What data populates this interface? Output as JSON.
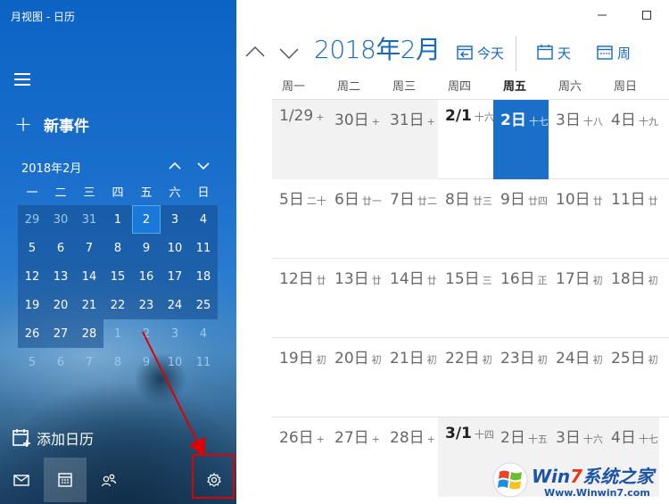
{
  "window": {
    "title": "月视图 - 日历"
  },
  "sidebar": {
    "new_event_label": "新事件",
    "mini_calendar": {
      "month_label": "2018年2月",
      "weekdays": [
        "一",
        "二",
        "三",
        "四",
        "五",
        "六",
        "日"
      ],
      "weeks": [
        [
          "29",
          "30",
          "31",
          "1",
          "2",
          "3",
          "4"
        ],
        [
          "5",
          "6",
          "7",
          "8",
          "9",
          "10",
          "11"
        ],
        [
          "12",
          "13",
          "14",
          "15",
          "16",
          "17",
          "18"
        ],
        [
          "19",
          "20",
          "21",
          "22",
          "23",
          "24",
          "25"
        ],
        [
          "26",
          "27",
          "28",
          "1",
          "2",
          "3",
          "4"
        ],
        [
          "5",
          "6",
          "7",
          "8",
          "9",
          "10",
          "11"
        ]
      ]
    },
    "add_calendar_label": "添加日历",
    "bottom_nav": [
      "mail-icon",
      "calendar-icon",
      "people-icon",
      "settings-icon"
    ]
  },
  "toolbar": {
    "month_title": "2018年2月",
    "today_label": "今天",
    "day_label": "天",
    "week_label": "周"
  },
  "month_view": {
    "weekdays": [
      "周一",
      "周二",
      "周三",
      "周四",
      "周五",
      "周六",
      "周日"
    ],
    "current_weekday": "周五",
    "weeks": [
      [
        {
          "d": "1/29",
          "l": "+"
        },
        {
          "d": "30日",
          "l": "+"
        },
        {
          "d": "31日",
          "l": "+"
        },
        {
          "d": "2/1",
          "l": "十六"
        },
        {
          "d": "2日",
          "l": "十七"
        },
        {
          "d": "3日",
          "l": "十八"
        },
        {
          "d": "4日",
          "l": "十九"
        }
      ],
      [
        {
          "d": "5日",
          "l": "二十"
        },
        {
          "d": "6日",
          "l": "廿一"
        },
        {
          "d": "7日",
          "l": "廿二"
        },
        {
          "d": "8日",
          "l": "廿三"
        },
        {
          "d": "9日",
          "l": "廿四"
        },
        {
          "d": "10日",
          "l": "廿"
        },
        {
          "d": "11日",
          "l": "廿"
        }
      ],
      [
        {
          "d": "12日",
          "l": "廿"
        },
        {
          "d": "13日",
          "l": "廿"
        },
        {
          "d": "14日",
          "l": "廿"
        },
        {
          "d": "15日",
          "l": "三"
        },
        {
          "d": "16日",
          "l": "正"
        },
        {
          "d": "17日",
          "l": "初"
        },
        {
          "d": "18日",
          "l": "初"
        }
      ],
      [
        {
          "d": "19日",
          "l": "初"
        },
        {
          "d": "20日",
          "l": "初"
        },
        {
          "d": "21日",
          "l": "初"
        },
        {
          "d": "22日",
          "l": "初"
        },
        {
          "d": "23日",
          "l": "初"
        },
        {
          "d": "24日",
          "l": "初"
        },
        {
          "d": "25日",
          "l": "初"
        }
      ],
      [
        {
          "d": "26日",
          "l": "+"
        },
        {
          "d": "27日",
          "l": "+"
        },
        {
          "d": "28日",
          "l": "+"
        },
        {
          "d": "3/1",
          "l": "十四"
        },
        {
          "d": "2日",
          "l": "十五"
        },
        {
          "d": "3日",
          "l": "十六"
        },
        {
          "d": "4日",
          "l": "十七"
        }
      ]
    ]
  },
  "watermark": {
    "brand_a": "Win",
    "brand_b": "7",
    "brand_c": "系统之家",
    "url": "Www.Winwin7.com"
  },
  "colors": {
    "accent": "#1568c4",
    "today_bg": "#1a6fc8",
    "highlight_box": "#e00000"
  }
}
